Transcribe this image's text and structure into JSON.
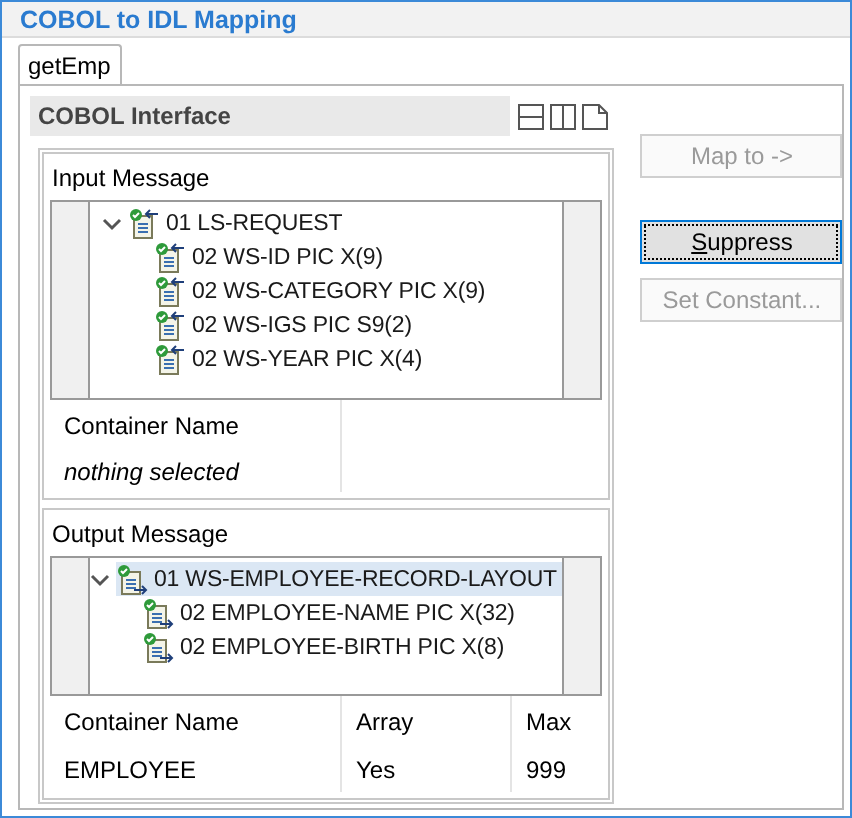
{
  "window": {
    "title": "COBOL to IDL Mapping"
  },
  "tabs": [
    {
      "label": "getEmp",
      "selected": true
    }
  ],
  "section": {
    "title": "COBOL Interface"
  },
  "input_message": {
    "title": "Input Message",
    "tree": [
      {
        "label": "01 LS-REQUEST",
        "expanded": true,
        "selected": false,
        "children": [
          {
            "label": "02 WS-ID PIC X(9)",
            "selected": false
          },
          {
            "label": "02 WS-CATEGORY PIC X(9)",
            "selected": false
          },
          {
            "label": "02 WS-IGS PIC S9(2)",
            "selected": false
          },
          {
            "label": "02 WS-YEAR PIC X(4)",
            "selected": false
          }
        ]
      }
    ],
    "table": {
      "columns": [
        "Container Name"
      ],
      "empty_text": "nothing selected"
    }
  },
  "output_message": {
    "title": "Output Message",
    "tree": [
      {
        "label": "01 WS-EMPLOYEE-RECORD-LAYOUT",
        "expanded": true,
        "selected": true,
        "children": [
          {
            "label": "02 EMPLOYEE-NAME PIC X(32)",
            "selected": false
          },
          {
            "label": "02 EMPLOYEE-BIRTH PIC X(8)",
            "selected": false
          }
        ]
      }
    ],
    "table": {
      "columns": [
        "Container Name",
        "Array",
        "Max"
      ],
      "rows": [
        [
          "EMPLOYEE",
          "Yes",
          "999"
        ]
      ]
    }
  },
  "buttons": [
    {
      "label": "Map to ->",
      "disabled": true,
      "focused": false
    },
    {
      "label": "Suppress",
      "disabled": false,
      "focused": true,
      "mnemonic_underlined": true
    },
    {
      "label": "Set Constant...",
      "disabled": true,
      "focused": false
    }
  ]
}
